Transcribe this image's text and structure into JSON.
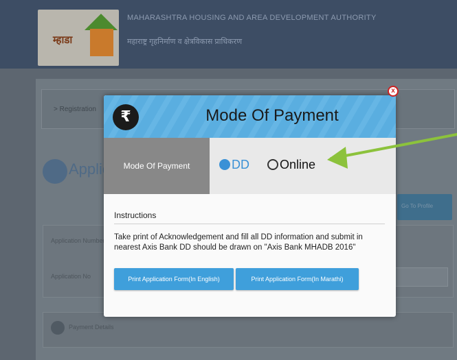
{
  "background": {
    "logo_text": "म्हाडा",
    "org_title": "MAHARASHTRA HOUSING AND AREA DEVELOPMENT AUTHORITY",
    "org_subtitle": "महाराष्ट्र गृहनिर्माण व क्षेत्रविकास प्राधिकरण",
    "breadcrumb": "> Registration",
    "app_title": "Applic",
    "right_button": "Go To Profile",
    "form_label_1": "Application Number",
    "form_label_2": "Application No",
    "section_title": "Payment Details"
  },
  "modal": {
    "title": "Mode Of Payment",
    "currency_icon_glyph": "₹",
    "mode_label": "Mode Of Payment",
    "options": [
      {
        "label": "DD",
        "selected": true
      },
      {
        "label": "Online",
        "selected": false
      }
    ],
    "instructions_title": "Instructions",
    "instructions_text": "Take print of Acknowledgement and fill all DD information and submit in nearest Axis Bank DD should be drawn on \"Axis Bank MHADB 2016\"",
    "buttons": {
      "print_english": "Print Application Form(In English)",
      "print_marathi": "Print Application Form(In Marathi)"
    },
    "close_glyph": "x"
  },
  "colors": {
    "header_blue": "#5aaee0",
    "button_blue": "#3f9fdb",
    "arrow_green": "#8cc23c",
    "close_red": "#cc2222"
  }
}
